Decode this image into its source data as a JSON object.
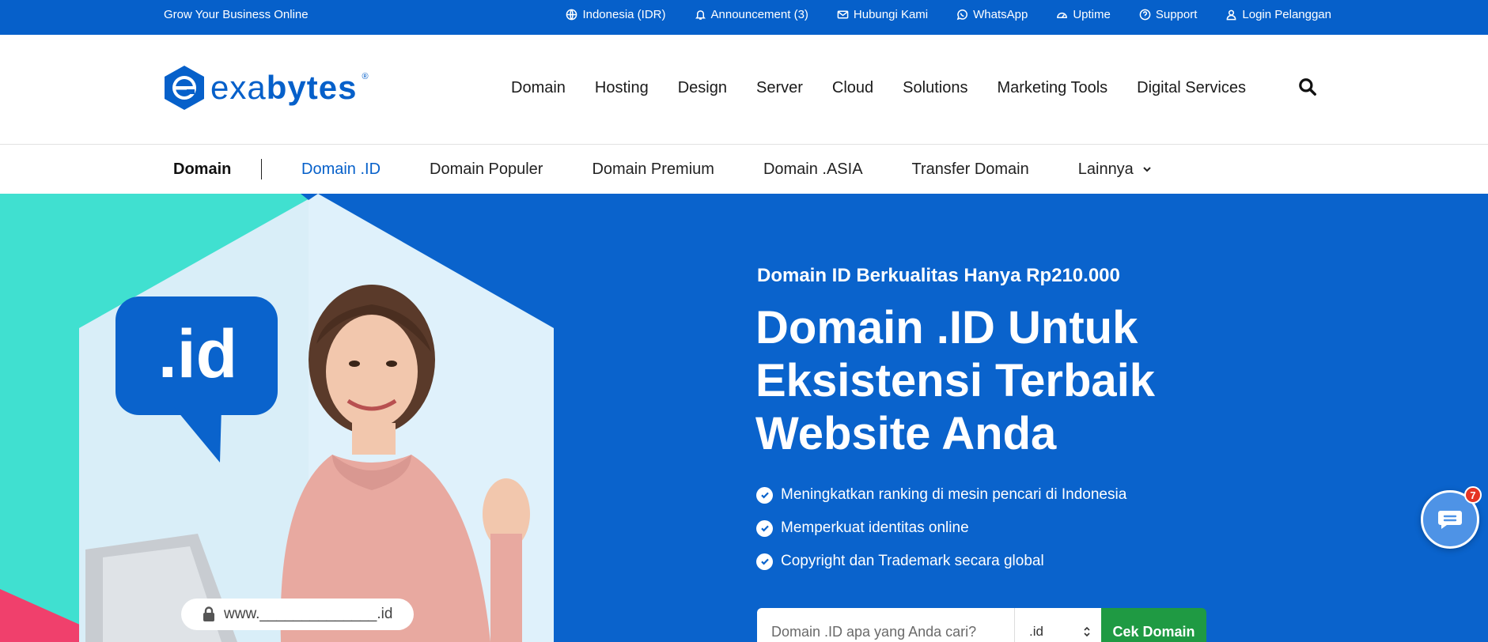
{
  "topbar": {
    "tagline": "Grow Your Business Online",
    "links": [
      {
        "icon": "globe-icon",
        "label": "Indonesia (IDR)"
      },
      {
        "icon": "bell-icon",
        "label": "Announcement (3)"
      },
      {
        "icon": "mail-icon",
        "label": "Hubungi Kami"
      },
      {
        "icon": "whatsapp-icon",
        "label": "WhatsApp"
      },
      {
        "icon": "speedometer-icon",
        "label": "Uptime"
      },
      {
        "icon": "help-circle-icon",
        "label": "Support"
      },
      {
        "icon": "user-icon",
        "label": "Login Pelanggan"
      }
    ]
  },
  "header": {
    "logo": {
      "prefix": "exa",
      "bold": "bytes",
      "mark": "®"
    },
    "nav": [
      "Domain",
      "Hosting",
      "Design",
      "Server",
      "Cloud",
      "Solutions",
      "Marketing Tools",
      "Digital Services"
    ]
  },
  "subnav": {
    "title": "Domain",
    "items": [
      "Domain .ID",
      "Domain Populer",
      "Domain Premium",
      "Domain .ASIA",
      "Transfer Domain",
      "Lainnya"
    ]
  },
  "hero": {
    "badge_text": ".id",
    "url_pill": "www.______________.id",
    "subtitle": "Domain ID Berkualitas Hanya Rp210.000",
    "title": "Domain .ID Untuk Eksistensi Terbaik Website Anda",
    "benefits": [
      "Meningkatkan ranking di mesin pencari di Indonesia",
      "Memperkuat identitas online",
      "Copyright dan Trademark secara global"
    ],
    "search": {
      "placeholder": "Domain .ID apa yang Anda cari?",
      "tld": ".id",
      "button": "Cek Domain"
    }
  },
  "chat": {
    "badge": "7"
  },
  "colors": {
    "brand_blue": "#0660ca",
    "hero_blue": "#0a63cc",
    "teal": "#40e0d0",
    "pink": "#f0406c",
    "green": "#1f9a43"
  }
}
